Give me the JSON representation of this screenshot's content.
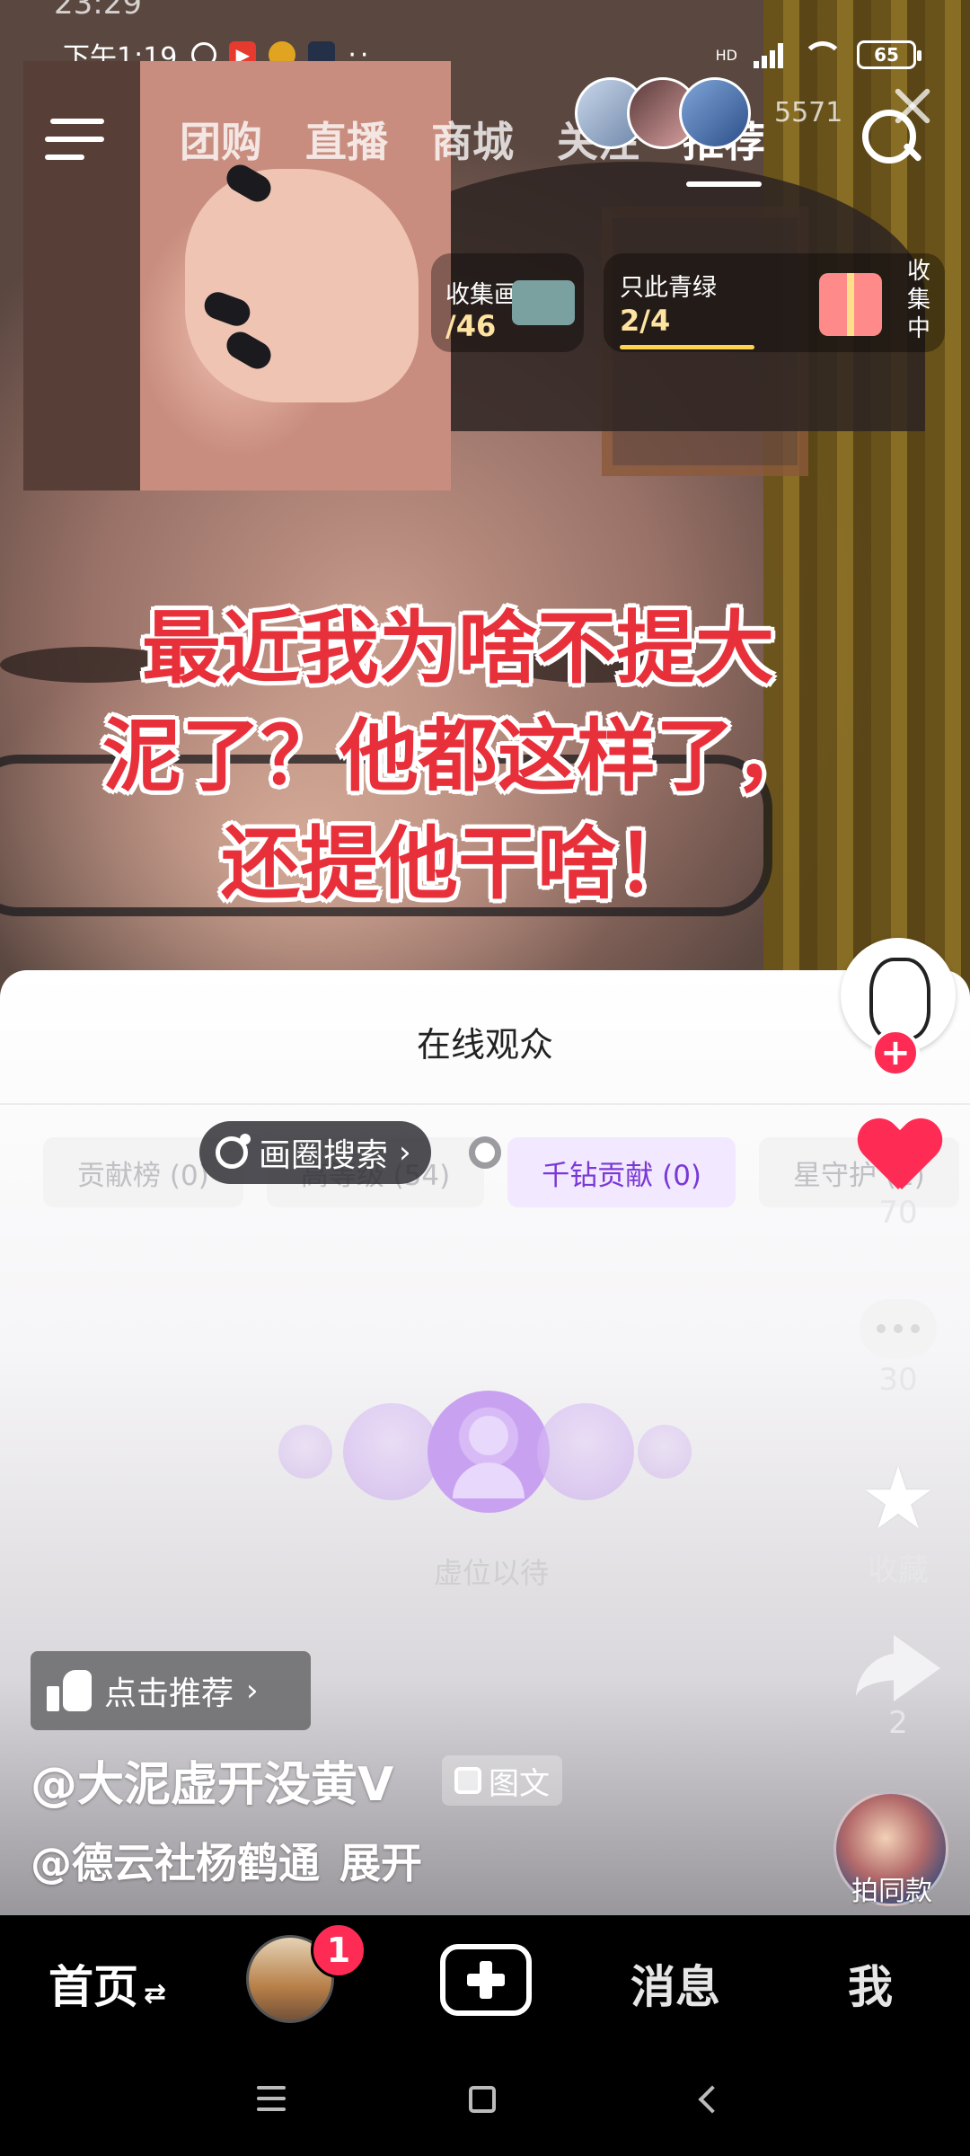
{
  "status_bar": {
    "clipped_time": "23:29",
    "time": "下午1:19",
    "network_type": "HD",
    "battery_level": "65",
    "icons": [
      "alarm-icon",
      "video-app-icon",
      "weibo-icon",
      "notify-icon",
      "more-dots-icon",
      "signal-icon",
      "wifi-icon",
      "battery-icon"
    ]
  },
  "top_nav": {
    "tabs": [
      "团购",
      "直播",
      "商城",
      "关注",
      "推荐"
    ],
    "active_tab": "推荐",
    "viewer_count": "5571"
  },
  "progress_chips": {
    "scroll_label": "收集画卷",
    "scroll_value": "/46",
    "green_label": "只此青绿",
    "green_value": "2/4",
    "collecting": "收集中"
  },
  "caption": {
    "line1": "最近我为啥不提大",
    "line2": "泥了？他都这样了，",
    "line3": "还提他干啥！"
  },
  "online_panel": {
    "title": "在线观众",
    "tabs": [
      "贡献榜 (0)",
      "高等级 (54)",
      "千钻贡献 (0)",
      "星守护 (2)"
    ],
    "selected_tab": "千钻贡献 (0)",
    "placeholder_text": "虚位以待"
  },
  "circle_search": {
    "label": "画圈搜索"
  },
  "right_rail": {
    "likes": "70",
    "comments": "30",
    "favorite_label": "收藏",
    "shares": "2",
    "same_style_label": "拍同款"
  },
  "post": {
    "recommend_label": "点击推荐",
    "author": "@大泥虚开没黄V",
    "post_type": "图文",
    "mention": "@德云社杨鹤通",
    "expand_label": "展开"
  },
  "bottom_nav": {
    "home": "首页",
    "notification_count": "1",
    "messages": "消息",
    "me": "我"
  },
  "colors": {
    "accent_red": "#fe2c55",
    "caption_red": "#e8303b",
    "selected_tab_purple": "#7a38d6"
  }
}
